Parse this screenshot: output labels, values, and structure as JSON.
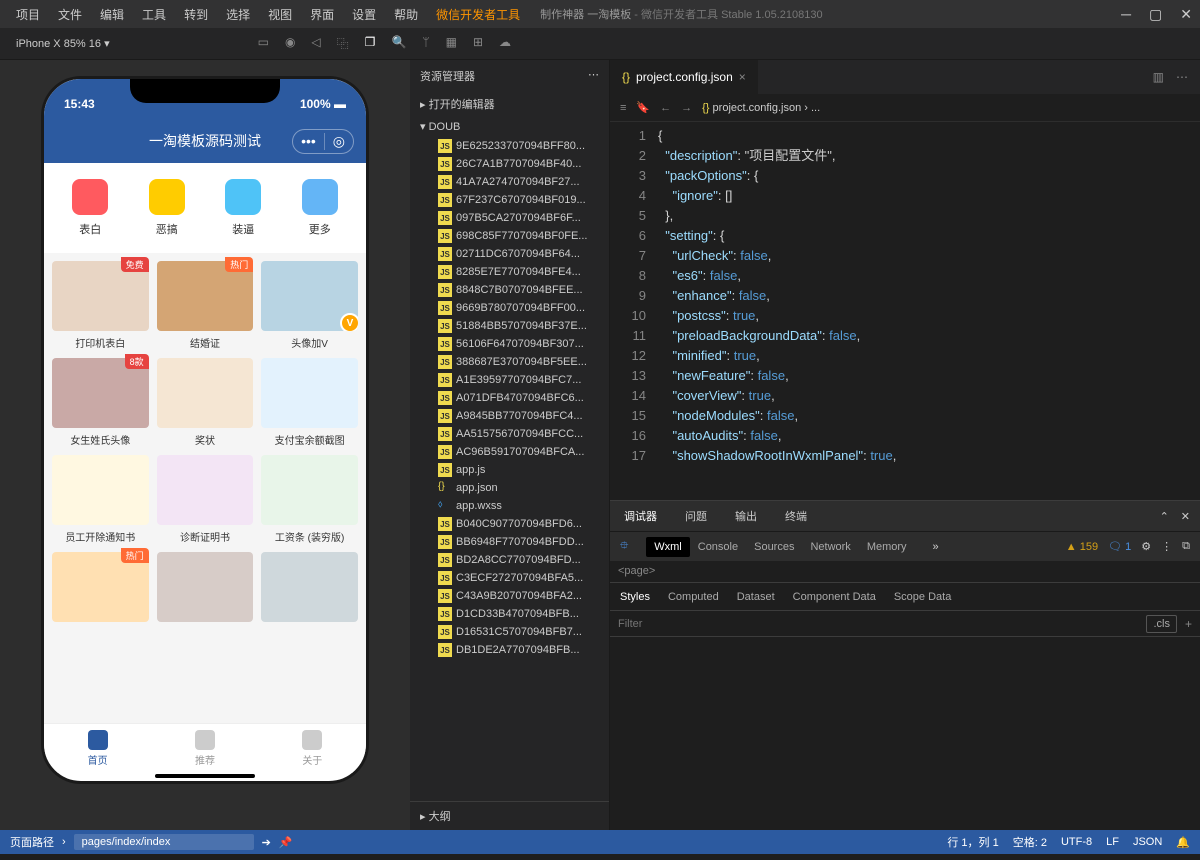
{
  "menu": [
    "项目",
    "文件",
    "编辑",
    "工具",
    "转到",
    "选择",
    "视图",
    "界面",
    "设置",
    "帮助",
    "微信开发者工具"
  ],
  "title_suffix": "制作神器 一淘模板",
  "title_app": " - 微信开发者工具 Stable 1.05.2108130",
  "device": "iPhone X 85% 16 ▾",
  "phone": {
    "time": "15:43",
    "battery": "100%",
    "app_title": "一淘模板源码测试"
  },
  "categories": [
    {
      "label": "表白",
      "color": "#ff5a5f"
    },
    {
      "label": "恶搞",
      "color": "#ffcc00"
    },
    {
      "label": "装逼",
      "color": "#4fc3f7"
    },
    {
      "label": "更多",
      "color": "#64b5f6"
    }
  ],
  "cards": [
    {
      "label": "打印机表白",
      "badge": "免费",
      "badge_cls": "red"
    },
    {
      "label": "结婚证",
      "badge": "热门",
      "badge_cls": "org"
    },
    {
      "label": "头像加V",
      "v": true
    },
    {
      "label": "女生姓氏头像",
      "badge": "8款",
      "badge_cls": "red"
    },
    {
      "label": "奖状"
    },
    {
      "label": "支付宝余额截图"
    },
    {
      "label": "员工开除通知书"
    },
    {
      "label": "诊断证明书"
    },
    {
      "label": "工资条 (装穷版)"
    },
    {
      "label": "",
      "badge": "热门",
      "badge_cls": "org"
    },
    {
      "label": ""
    },
    {
      "label": ""
    }
  ],
  "tabs": [
    {
      "label": "首页",
      "active": true
    },
    {
      "label": "推荐"
    },
    {
      "label": "关于"
    }
  ],
  "explorer": {
    "title": "资源管理器",
    "sections": [
      "打开的编辑器",
      "DOUB"
    ],
    "outline": "大纲",
    "files": [
      "9E625233707094BFF80...",
      "26C7A1B7707094BF40...",
      "41A7A274707094BF27...",
      "67F237C6707094BF019...",
      "097B5CA2707094BF6F...",
      "698C85F7707094BF0FE...",
      "02711DC6707094BF64...",
      "8285E7E7707094BFE4...",
      "8848C7B0707094BFEE...",
      "9669B780707094BFF00...",
      "51884BB5707094BF37E...",
      "56106F64707094BF307...",
      "388687E3707094BF5EE...",
      "A1E39597707094BFC7...",
      "A071DFB4707094BFC6...",
      "A9845BB7707094BFC4...",
      "AA515756707094BFCC...",
      "AC96B591707094BFCA...",
      "app.js",
      "app.json",
      "app.wxss",
      "B040C907707094BFD6...",
      "BB6948F7707094BFDD...",
      "BD2A8CC7707094BFD...",
      "C3ECF272707094BFA5...",
      "C43A9B20707094BFA2...",
      "D1CD33B4707094BFB...",
      "D16531C5707094BFB7...",
      "DB1DE2A7707094BFB..."
    ]
  },
  "editor": {
    "tab": "project.config.json",
    "breadcrumb": "project.config.json › ...",
    "code": [
      {
        "n": 1,
        "t": "{"
      },
      {
        "n": 2,
        "t": "  \"description\": \"项目配置文件\","
      },
      {
        "n": 3,
        "t": "  \"packOptions\": {"
      },
      {
        "n": 4,
        "t": "    \"ignore\": []"
      },
      {
        "n": 5,
        "t": "  },"
      },
      {
        "n": 6,
        "t": "  \"setting\": {"
      },
      {
        "n": 7,
        "t": "    \"urlCheck\": false,"
      },
      {
        "n": 8,
        "t": "    \"es6\": false,"
      },
      {
        "n": 9,
        "t": "    \"enhance\": false,"
      },
      {
        "n": 10,
        "t": "    \"postcss\": true,"
      },
      {
        "n": 11,
        "t": "    \"preloadBackgroundData\": false,"
      },
      {
        "n": 12,
        "t": "    \"minified\": true,"
      },
      {
        "n": 13,
        "t": "    \"newFeature\": false,"
      },
      {
        "n": 14,
        "t": "    \"coverView\": true,"
      },
      {
        "n": 15,
        "t": "    \"nodeModules\": false,"
      },
      {
        "n": 16,
        "t": "    \"autoAudits\": false,"
      },
      {
        "n": 17,
        "t": "    \"showShadowRootInWxmlPanel\": true,"
      }
    ]
  },
  "devtools": {
    "top_tabs": [
      "调试器",
      "问题",
      "输出",
      "终端"
    ],
    "sub_tabs": [
      "Wxml",
      "Console",
      "Sources",
      "Network",
      "Memory"
    ],
    "warn_count": "159",
    "info_count": "1",
    "style_tabs": [
      "Styles",
      "Computed",
      "Dataset",
      "Component Data",
      "Scope Data"
    ],
    "filter_placeholder": "Filter",
    "cls": ".cls"
  },
  "statusbar": {
    "path_label": "页面路径",
    "path_value": "pages/index/index",
    "pos": "行 1，列 1",
    "spaces": "空格: 2",
    "enc": "UTF-8",
    "eol": "LF",
    "lang": "JSON"
  }
}
